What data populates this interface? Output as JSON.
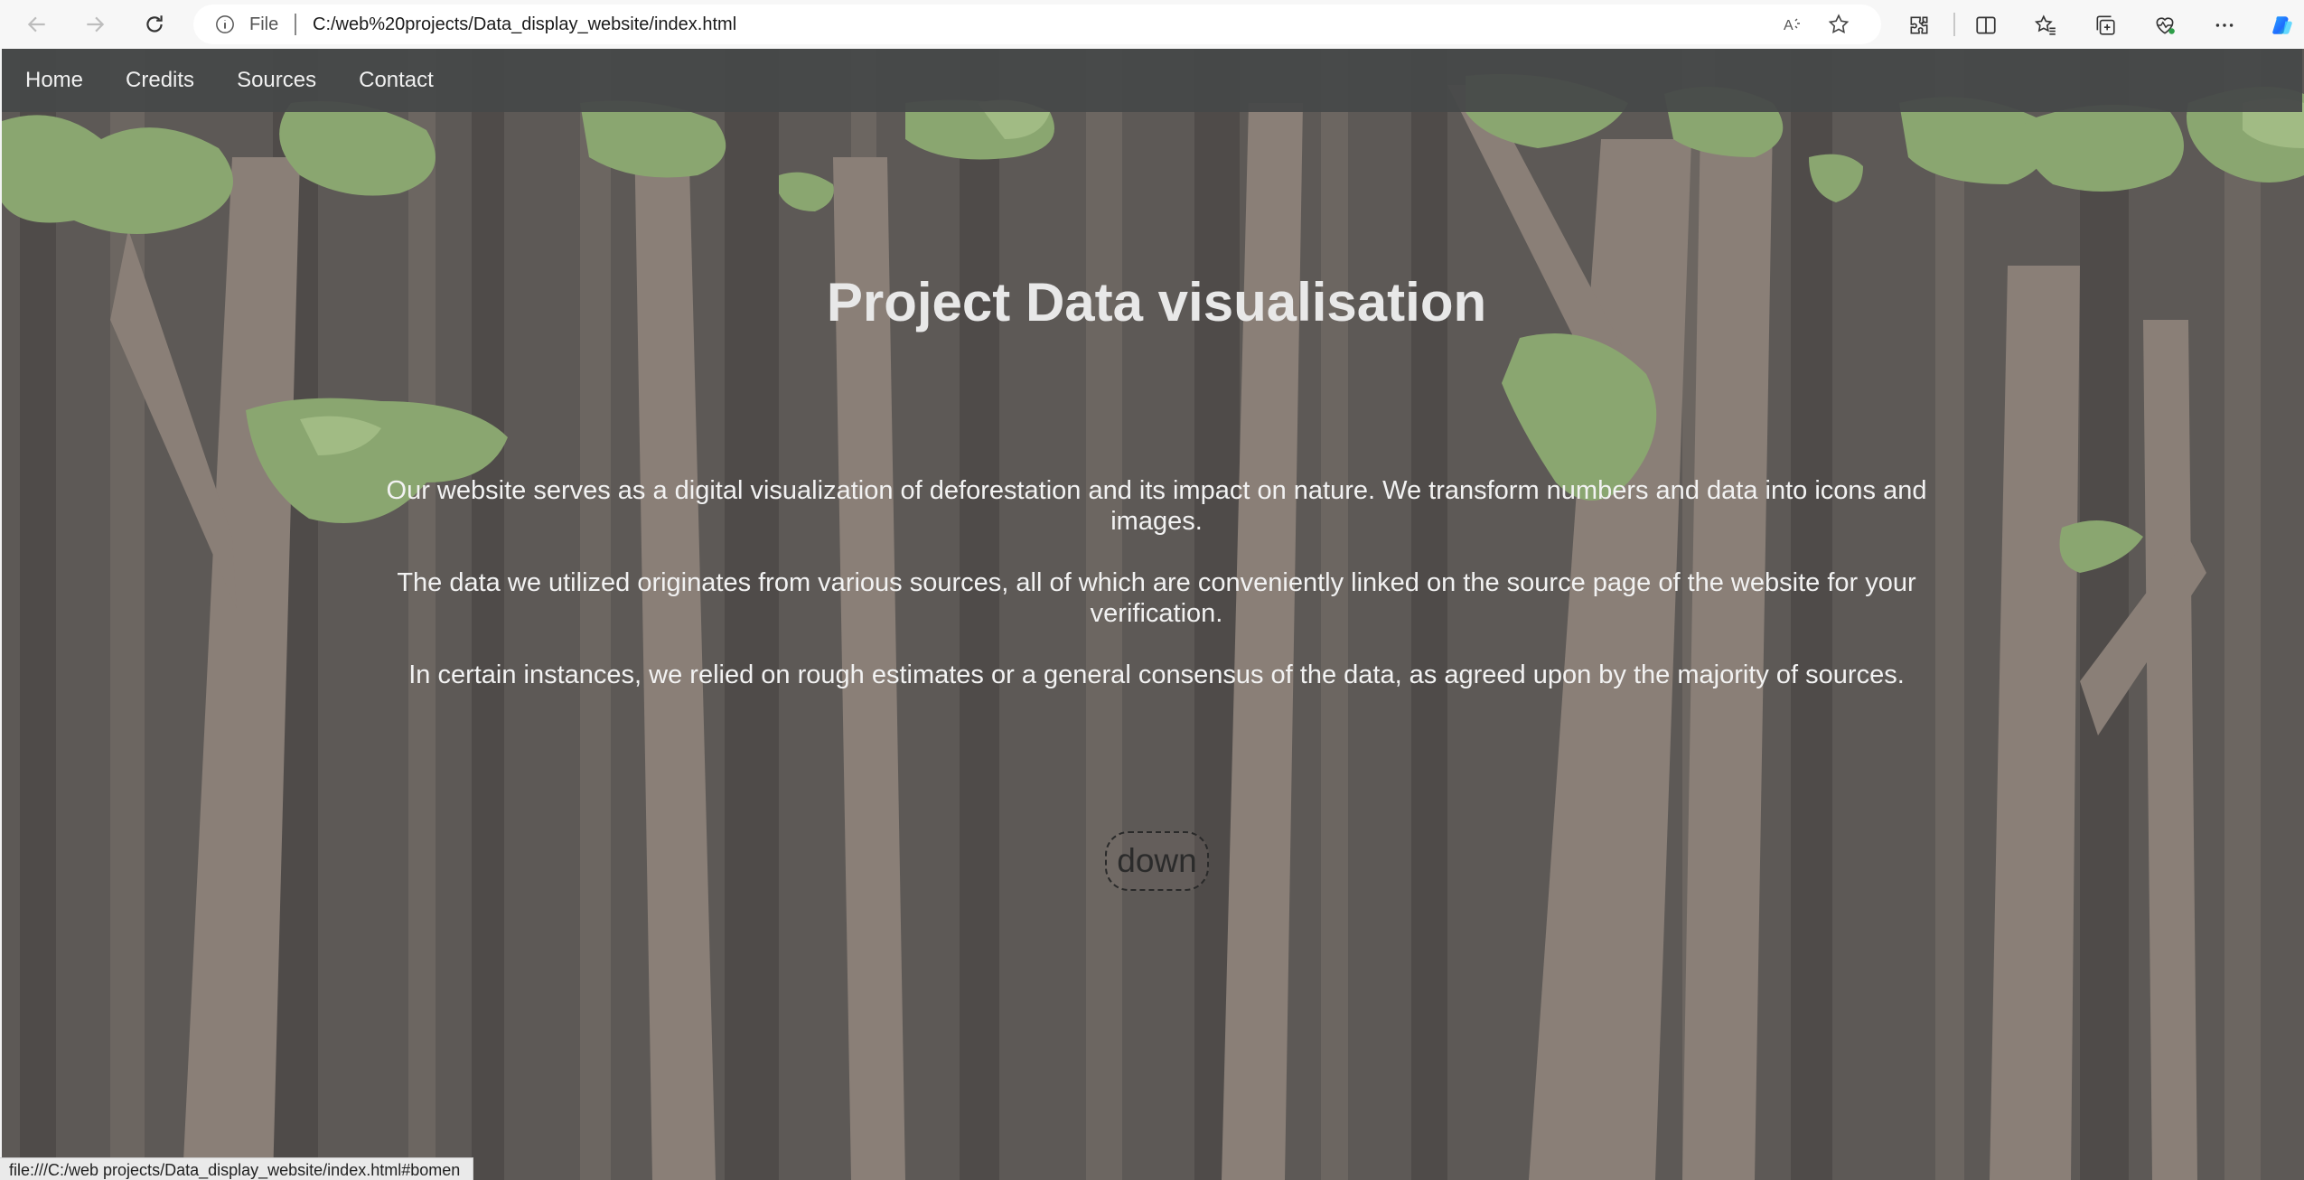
{
  "browser": {
    "address_scheme": "File",
    "url": "C:/web%20projects/Data_display_website/index.html",
    "status_url": "file:///C:/web projects/Data_display_website/index.html#bomen",
    "icons": {
      "back": "back-arrow-icon",
      "forward": "forward-arrow-icon",
      "refresh": "refresh-icon",
      "info": "info-icon",
      "read_aloud": "read-aloud-icon",
      "favorite": "star-icon",
      "extensions": "puzzle-icon",
      "split": "split-screen-icon",
      "favorites": "favorites-icon",
      "collections": "collections-icon",
      "health": "heart-pulse-icon",
      "more": "more-icon",
      "copilot": "copilot-icon"
    }
  },
  "nav": {
    "items": [
      {
        "label": "Home"
      },
      {
        "label": "Credits"
      },
      {
        "label": "Sources"
      },
      {
        "label": "Contact"
      }
    ]
  },
  "hero": {
    "title": "Project Data visualisation",
    "paragraphs": [
      "Our website serves as a digital visualization of deforestation and its impact on nature. We transform numbers and data into icons and images.",
      "The data we utilized originates from various sources, all of which are conveniently linked on the source page of the website for your verification.",
      "In certain instances, we relied on rough estimates or a general consensus of the data, as agreed upon by the majority of sources."
    ],
    "down_label": "down"
  },
  "colors": {
    "nav_bg": "#464848",
    "forest_bg": "#5d5956",
    "trunk": "#8a7f77",
    "leaf": "#8aa670"
  }
}
